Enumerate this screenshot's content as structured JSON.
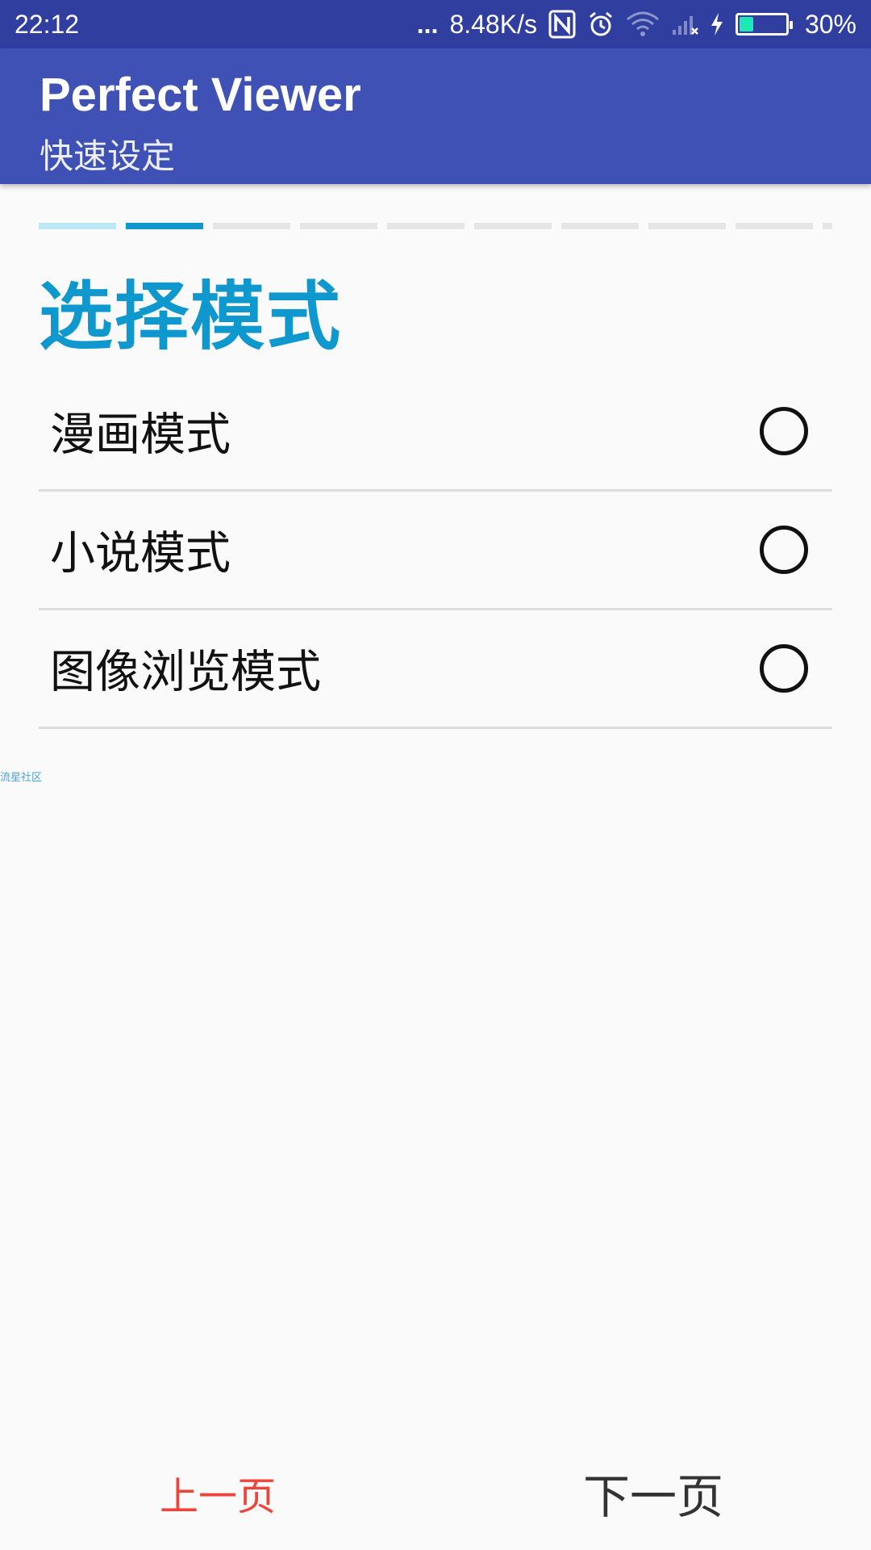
{
  "status_bar": {
    "time": "22:12",
    "dots": "...",
    "network_speed": "8.48K/s",
    "battery_percent": "30%",
    "battery_level": 0.3,
    "icons": [
      "nfc-icon",
      "alarm-icon",
      "wifi-icon",
      "cell-signal-icon",
      "charging-icon",
      "battery-icon"
    ]
  },
  "app_bar": {
    "title": "Perfect Viewer",
    "subtitle": "快速设定"
  },
  "wizard": {
    "total_steps": 9,
    "current_step": 2,
    "heading": "选择模式",
    "options": [
      {
        "label": "漫画模式",
        "selected": false
      },
      {
        "label": "小说模式",
        "selected": false
      },
      {
        "label": "图像浏览模式",
        "selected": false
      }
    ]
  },
  "watermark": "流星社区",
  "navigation": {
    "prev_label": "上一页",
    "next_label": "下一页"
  },
  "colors": {
    "status_bar": "#303f9f",
    "app_bar": "#3f51b5",
    "accent": "#0f98ce",
    "prev_button": "#f0433a"
  }
}
